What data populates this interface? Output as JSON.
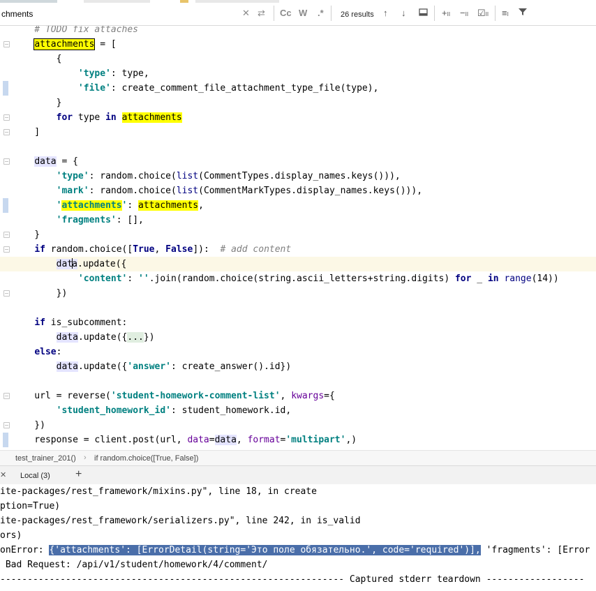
{
  "search": {
    "query": "chments",
    "results": "26 results",
    "icons": [
      "close-icon",
      "replace-icon",
      "match-case-icon",
      "whole-word-icon",
      "regex-icon",
      "prev-occurrence-icon",
      "next-occurrence-icon",
      "filter-popup-icon",
      "add-selection-icon",
      "remove-selection-icon",
      "select-all-icon",
      "multiline-icon",
      "filter-icon"
    ],
    "cc_label": "Cc",
    "w_label": "W",
    "regex_label": ".*"
  },
  "editor": {
    "lines": [
      {
        "segments": [
          {
            "t": "    # TODO fix attaches",
            "c": "cmt"
          }
        ]
      },
      {
        "segments": [
          {
            "t": "    "
          },
          {
            "t": "attachments",
            "c": "hl-box"
          },
          {
            "t": " = ["
          }
        ]
      },
      {
        "segments": [
          {
            "t": "        {"
          }
        ]
      },
      {
        "segments": [
          {
            "t": "            "
          },
          {
            "t": "'type'",
            "c": "str"
          },
          {
            "t": ": type,"
          }
        ]
      },
      {
        "segments": [
          {
            "t": "            "
          },
          {
            "t": "'file'",
            "c": "str"
          },
          {
            "t": ": create_comment_file_attachment_type_file(type),"
          }
        ]
      },
      {
        "segments": [
          {
            "t": "        }"
          }
        ]
      },
      {
        "segments": [
          {
            "t": "        "
          },
          {
            "t": "for",
            "c": "kw"
          },
          {
            "t": " type "
          },
          {
            "t": "in",
            "c": "kw"
          },
          {
            "t": " "
          },
          {
            "t": "attachments",
            "c": "hl"
          }
        ]
      },
      {
        "segments": [
          {
            "t": "    ]"
          }
        ]
      },
      {
        "segments": [
          {
            "t": ""
          }
        ]
      },
      {
        "segments": [
          {
            "t": "    "
          },
          {
            "t": "data",
            "c": "var-use"
          },
          {
            "t": " = {"
          }
        ]
      },
      {
        "segments": [
          {
            "t": "        "
          },
          {
            "t": "'type'",
            "c": "str"
          },
          {
            "t": ": random.choice("
          },
          {
            "t": "list",
            "c": "builtin"
          },
          {
            "t": "(CommentTypes.display_names.keys())),"
          }
        ]
      },
      {
        "segments": [
          {
            "t": "        "
          },
          {
            "t": "'mark'",
            "c": "str"
          },
          {
            "t": ": random.choice("
          },
          {
            "t": "list",
            "c": "builtin"
          },
          {
            "t": "(CommentMarkTypes.display_names.keys())),"
          }
        ]
      },
      {
        "segments": [
          {
            "t": "        "
          },
          {
            "t": "'",
            "c": "str"
          },
          {
            "t": "attachments",
            "c": "str hl"
          },
          {
            "t": "'",
            "c": "str"
          },
          {
            "t": ": "
          },
          {
            "t": "attachments",
            "c": "hl"
          },
          {
            "t": ","
          }
        ]
      },
      {
        "segments": [
          {
            "t": "        "
          },
          {
            "t": "'fragments'",
            "c": "str"
          },
          {
            "t": ": [],"
          }
        ]
      },
      {
        "segments": [
          {
            "t": "    }"
          }
        ]
      },
      {
        "segments": [
          {
            "t": "    "
          },
          {
            "t": "if",
            "c": "kw"
          },
          {
            "t": " random.choice(["
          },
          {
            "t": "True",
            "c": "kw"
          },
          {
            "t": ", "
          },
          {
            "t": "False",
            "c": "kw"
          },
          {
            "t": "]):  "
          },
          {
            "t": "# add content",
            "c": "cmt"
          }
        ]
      },
      {
        "current": true,
        "segments": [
          {
            "t": "        "
          },
          {
            "t": "dat",
            "c": "var-use"
          },
          {
            "caret": true
          },
          {
            "t": "a",
            "c": "var-use"
          },
          {
            "t": ".update({"
          }
        ]
      },
      {
        "segments": [
          {
            "t": "            "
          },
          {
            "t": "'content'",
            "c": "str"
          },
          {
            "t": ": "
          },
          {
            "t": "''",
            "c": "str"
          },
          {
            "t": ".join(random.choice(string.ascii_letters+string.digits) "
          },
          {
            "t": "for",
            "c": "kw"
          },
          {
            "t": " _ "
          },
          {
            "t": "in",
            "c": "kw"
          },
          {
            "t": " "
          },
          {
            "t": "range",
            "c": "builtin"
          },
          {
            "t": "(14))"
          }
        ]
      },
      {
        "segments": [
          {
            "t": "        })"
          }
        ]
      },
      {
        "segments": [
          {
            "t": ""
          }
        ]
      },
      {
        "segments": [
          {
            "t": "    "
          },
          {
            "t": "if",
            "c": "kw"
          },
          {
            "t": " is_subcomment:"
          }
        ]
      },
      {
        "segments": [
          {
            "t": "        "
          },
          {
            "t": "data",
            "c": "var-use"
          },
          {
            "t": ".update({"
          },
          {
            "t": "...",
            "c": "fold-dots"
          },
          {
            "t": "})"
          }
        ]
      },
      {
        "segments": [
          {
            "t": "    "
          },
          {
            "t": "else",
            "c": "kw"
          },
          {
            "t": ":"
          }
        ]
      },
      {
        "segments": [
          {
            "t": "        "
          },
          {
            "t": "data",
            "c": "var-use"
          },
          {
            "t": ".update({"
          },
          {
            "t": "'answer'",
            "c": "str"
          },
          {
            "t": ": create_answer().id})"
          }
        ]
      },
      {
        "segments": [
          {
            "t": ""
          }
        ]
      },
      {
        "segments": [
          {
            "t": "    url = reverse("
          },
          {
            "t": "'student-homework-comment-list'",
            "c": "str"
          },
          {
            "t": ", "
          },
          {
            "t": "kwargs",
            "c": "kwarg"
          },
          {
            "t": "={"
          }
        ]
      },
      {
        "segments": [
          {
            "t": "        "
          },
          {
            "t": "'student_homework_id'",
            "c": "str"
          },
          {
            "t": ": student_homework.id,"
          }
        ]
      },
      {
        "segments": [
          {
            "t": "    })"
          }
        ]
      },
      {
        "segments": [
          {
            "t": "    response = client.post(url, "
          },
          {
            "t": "data",
            "c": "kwarg"
          },
          {
            "t": "="
          },
          {
            "t": "data",
            "c": "var-use"
          },
          {
            "t": ", "
          },
          {
            "t": "format",
            "c": "kwarg"
          },
          {
            "t": "="
          },
          {
            "t": "'multipart'",
            "c": "str"
          },
          {
            "t": ",)"
          }
        ]
      }
    ]
  },
  "breadcrumb": {
    "function": "test_trainer_201()",
    "separator": "›",
    "statement": "if random.choice([True, False])"
  },
  "debug_tabs": {
    "close_glyph": "✕",
    "local_label": "Local (3)",
    "add_glyph": "+"
  },
  "console": {
    "lines": [
      {
        "segments": [
          {
            "t": "ite-packages/rest_framework/mixins.py\", line 18, in create"
          }
        ]
      },
      {
        "segments": [
          {
            "t": "ption=True)"
          }
        ]
      },
      {
        "segments": [
          {
            "t": "ite-packages/rest_framework/serializers.py\", line 242, in is_valid"
          }
        ]
      },
      {
        "segments": [
          {
            "t": "ors)"
          }
        ]
      },
      {
        "segments": [
          {
            "t": "onError: "
          },
          {
            "t": "{'attachments': [ErrorDetail(string='Это поле обязательно.', code='required')],",
            "c": "sel"
          },
          {
            "t": " 'fragments': [Error"
          }
        ]
      },
      {
        "segments": [
          {
            "t": " Bad Request: /api/v1/student/homework/4/comment/"
          }
        ]
      },
      {
        "segments": [
          {
            "t": "--------------------------------------------------------------- Captured stderr teardown ------------------"
          }
        ]
      },
      {
        "segments": [
          {
            "t": "  ."
          }
        ]
      }
    ]
  },
  "colors": {
    "search_highlight": "#ffff00",
    "selection": "#4a6ea9",
    "current_line": "#fcf8e6",
    "keyword": "#000080",
    "string": "#008080"
  }
}
